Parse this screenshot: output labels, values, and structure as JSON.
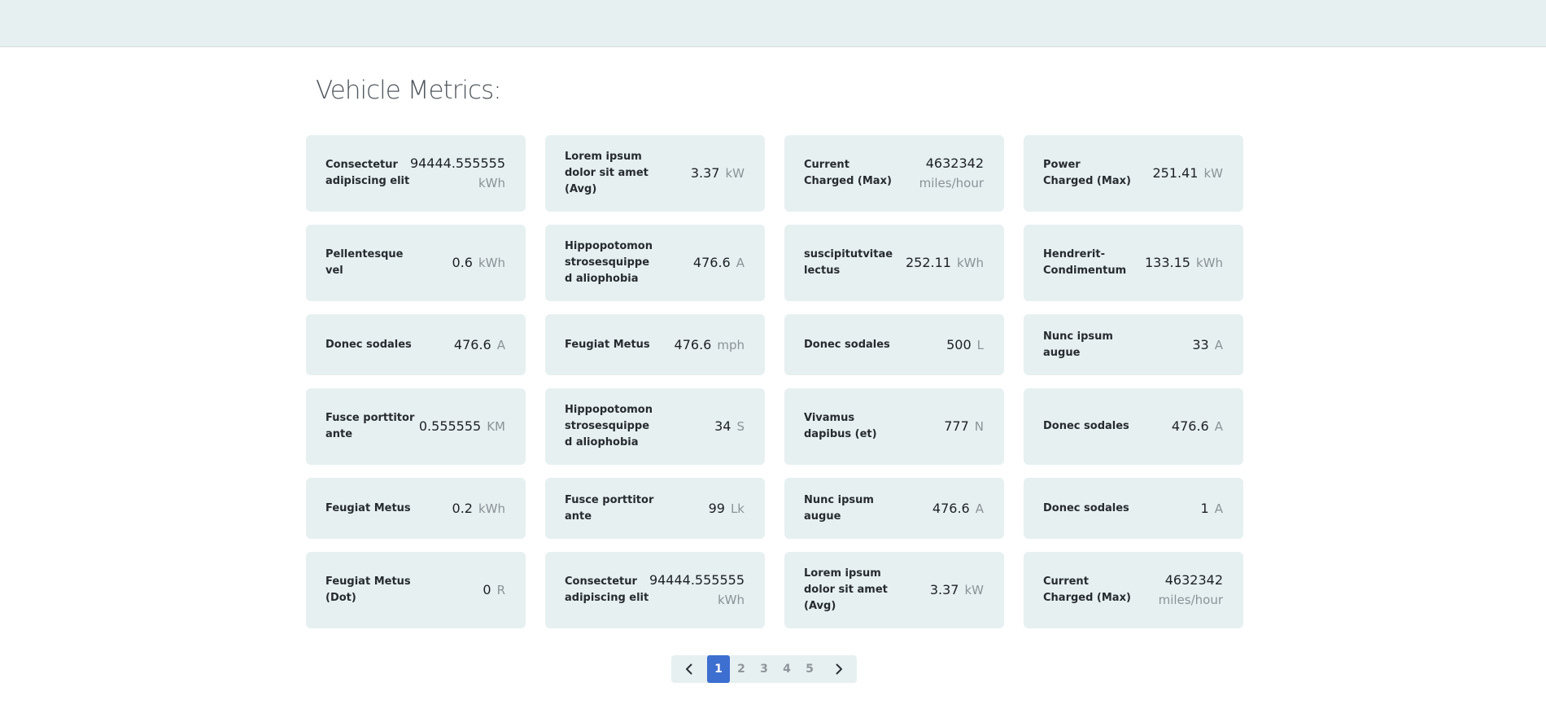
{
  "page": {
    "title": "Vehicle Metrics:"
  },
  "metrics": [
    {
      "label": "Consectetur adipiscing elit",
      "value": "94444.555555",
      "unit": "kWh",
      "stacked": true
    },
    {
      "label": "Lorem ipsum dolor sit amet (Avg)",
      "value": "3.37",
      "unit": "kW",
      "stacked": false
    },
    {
      "label": "Current Charged (Max)",
      "value": "4632342",
      "unit": "miles/hour",
      "stacked": true
    },
    {
      "label": "Power Charged (Max)",
      "value": "251.41",
      "unit": "kW",
      "stacked": false
    },
    {
      "label": "Pellentesque vel",
      "value": "0.6",
      "unit": "kWh",
      "stacked": false
    },
    {
      "label": "Hippopotomon strosesquipped aliophobia",
      "value": "476.6",
      "unit": "A",
      "stacked": false
    },
    {
      "label": "suscipitutvitaelectus",
      "value": "252.11",
      "unit": "kWh",
      "stacked": false
    },
    {
      "label": "Hendrerit-Condimentum",
      "value": "133.15",
      "unit": "kWh",
      "stacked": false
    },
    {
      "label": "Donec sodales",
      "value": "476.6",
      "unit": "A",
      "stacked": false
    },
    {
      "label": "Feugiat Metus",
      "value": "476.6",
      "unit": "mph",
      "stacked": false
    },
    {
      "label": "Donec sodales",
      "value": "500",
      "unit": "L",
      "stacked": false
    },
    {
      "label": "Nunc ipsum augue",
      "value": "33",
      "unit": "A",
      "stacked": false
    },
    {
      "label": "Fusce porttitor ante",
      "value": "0.555555",
      "unit": "KM",
      "stacked": false
    },
    {
      "label": "Hippopotomon strosesquipped aliophobia",
      "value": "34",
      "unit": "S",
      "stacked": false
    },
    {
      "label": "Vivamus dapibus (et)",
      "value": "777",
      "unit": "N",
      "stacked": false
    },
    {
      "label": "Donec sodales",
      "value": "476.6",
      "unit": "A",
      "stacked": false
    },
    {
      "label": "Feugiat Metus",
      "value": "0.2",
      "unit": "kWh",
      "stacked": false
    },
    {
      "label": "Fusce porttitor ante",
      "value": "99",
      "unit": "Lk",
      "stacked": false
    },
    {
      "label": "Nunc ipsum augue",
      "value": "476.6",
      "unit": "A",
      "stacked": false
    },
    {
      "label": "Donec sodales",
      "value": "1",
      "unit": "A",
      "stacked": false
    },
    {
      "label": "Feugiat Metus (Dot)",
      "value": "0",
      "unit": "R",
      "stacked": false
    },
    {
      "label": "Consectetur adipiscing elit",
      "value": "94444.555555",
      "unit": "kWh",
      "stacked": true
    },
    {
      "label": "Lorem ipsum dolor sit amet (Avg)",
      "value": "3.37",
      "unit": "kW",
      "stacked": false
    },
    {
      "label": "Current Charged (Max)",
      "value": "4632342",
      "unit": "miles/hour",
      "stacked": true
    }
  ],
  "pagination": {
    "prev_icon": "chevron-left-icon",
    "next_icon": "chevron-right-icon",
    "pages": [
      "1",
      "2",
      "3",
      "4",
      "5"
    ],
    "current": "1",
    "active_color": "#3d6fd0"
  }
}
